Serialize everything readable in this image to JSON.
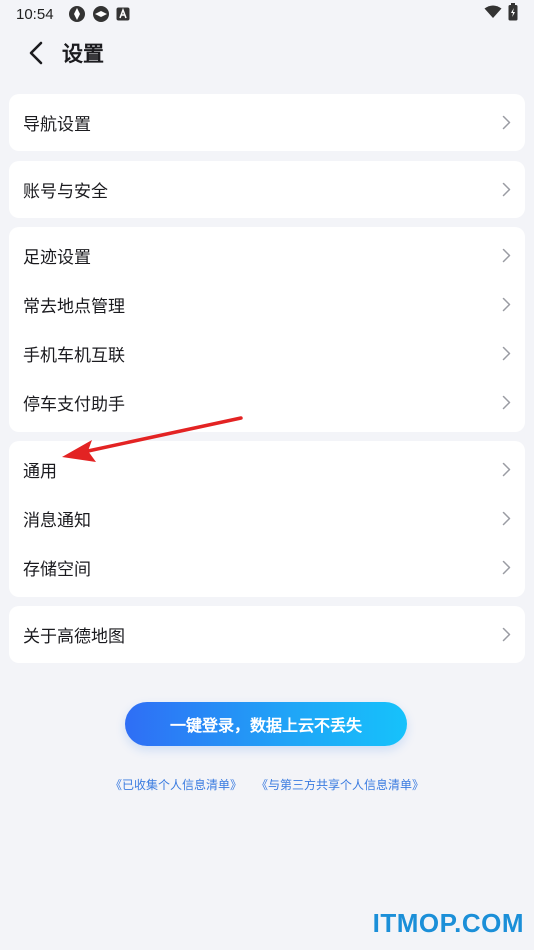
{
  "status_bar": {
    "time": "10:54",
    "icons": [
      "app-icon",
      "app-icon",
      "a-box-icon"
    ],
    "right_icons": [
      "wifi-icon",
      "battery-icon"
    ]
  },
  "header": {
    "back_icon": "chevron-left-icon",
    "title": "设置"
  },
  "groups": [
    {
      "items": [
        {
          "label": "导航设置"
        }
      ]
    },
    {
      "items": [
        {
          "label": "账号与安全"
        }
      ]
    },
    {
      "items": [
        {
          "label": "足迹设置"
        },
        {
          "label": "常去地点管理"
        },
        {
          "label": "手机车机互联"
        },
        {
          "label": "停车支付助手"
        }
      ]
    },
    {
      "items": [
        {
          "label": "通用"
        },
        {
          "label": "消息通知"
        },
        {
          "label": "存储空间"
        }
      ]
    },
    {
      "items": [
        {
          "label": "关于高德地图"
        }
      ]
    }
  ],
  "login": {
    "button_label": "一键登录，数据上云不丢失"
  },
  "links": {
    "collected_info": "《已收集个人信息清单》",
    "shared_info": "《与第三方共享个人信息清单》"
  },
  "watermark": "ITMOP.COM",
  "colors": {
    "background": "#f3f4f8",
    "card": "#ffffff",
    "link": "#3a7be0",
    "annotation_arrow": "#e32323",
    "watermark": "#1b8fd8"
  }
}
